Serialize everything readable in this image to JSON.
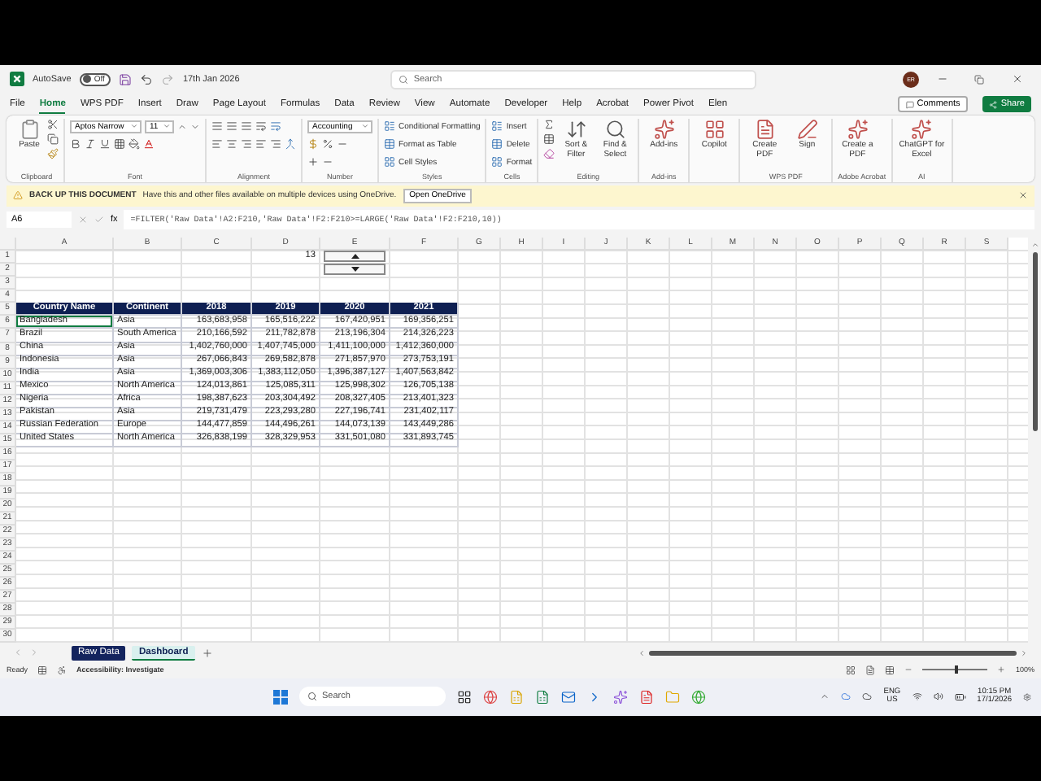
{
  "title_bar": {
    "autosave_label": "AutoSave",
    "autosave": {
      "label": "Off",
      "on": false
    },
    "file_name": "17th Jan 2026",
    "search_placeholder": "Search",
    "avatar": "ER"
  },
  "menu_tabs": [
    {
      "label": "File",
      "selected": false
    },
    {
      "label": "Home",
      "selected": true
    },
    {
      "label": "WPS PDF",
      "selected": false
    },
    {
      "label": "Insert",
      "selected": false
    },
    {
      "label": "Draw",
      "selected": false
    },
    {
      "label": "Page Layout",
      "selected": false
    },
    {
      "label": "Formulas",
      "selected": false
    },
    {
      "label": "Data",
      "selected": false
    },
    {
      "label": "Review",
      "selected": false
    },
    {
      "label": "View",
      "selected": false
    },
    {
      "label": "Automate",
      "selected": false
    },
    {
      "label": "Developer",
      "selected": false
    },
    {
      "label": "Help",
      "selected": false
    },
    {
      "label": "Acrobat",
      "selected": false
    },
    {
      "label": "Power Pivot",
      "selected": false
    },
    {
      "label": "Elen",
      "selected": false
    }
  ],
  "comments_button": "Comments",
  "share_button": "Share",
  "ribbon": {
    "groups": [
      {
        "kind": "clipboard",
        "label": "Clipboard",
        "paste": "Paste"
      },
      {
        "kind": "font",
        "label": "Font",
        "font": "Aptos Narrow",
        "size": "11"
      },
      {
        "kind": "alignment",
        "label": "Alignment"
      },
      {
        "kind": "number",
        "label": "Number",
        "format": "Accounting"
      },
      {
        "kind": "list",
        "label": "Styles",
        "items": [
          "Conditional Formatting",
          "Format as Table",
          "Cell Styles"
        ]
      },
      {
        "kind": "list",
        "label": "Cells",
        "items": [
          "Insert",
          "Delete",
          "Format"
        ]
      },
      {
        "kind": "editing",
        "label": "Editing",
        "items": [
          "Sort & Filter",
          "Find & Select"
        ]
      },
      {
        "kind": "large",
        "label": "Add-ins",
        "items": [
          "Add-ins"
        ]
      },
      {
        "kind": "large",
        "items": [
          "Copilot"
        ]
      },
      {
        "kind": "large",
        "label": "WPS PDF",
        "items": [
          "Create PDF",
          "Sign"
        ]
      },
      {
        "kind": "large",
        "label": "Adobe Acrobat",
        "items": [
          "Create a PDF"
        ]
      },
      {
        "kind": "large",
        "label": "AI",
        "items": [
          "ChatGPT for Excel"
        ]
      }
    ]
  },
  "message_bar": {
    "title": "BACK UP THIS DOCUMENT",
    "text": "Have this and other files available on multiple devices using OneDrive.",
    "button": "Open OneDrive"
  },
  "formula_bar": {
    "name_box": "A6",
    "function_label": "fx",
    "formula": "=FILTER('Raw Data'!A2:F210,'Raw Data'!F2:F210>=LARGE('Raw Data'!F2:F210,10))"
  },
  "sheet": {
    "columns": [
      "A",
      "B",
      "C",
      "D",
      "E",
      "F",
      "G",
      "H",
      "I",
      "J",
      "K",
      "L",
      "M",
      "N",
      "O",
      "P",
      "Q",
      "R",
      "S"
    ],
    "row_numbers": [
      "1",
      "2",
      "3",
      "4",
      "5",
      "6",
      "7",
      "8",
      "9",
      "10",
      "11",
      "12",
      "13",
      "14",
      "15",
      "16",
      "17",
      "18",
      "19",
      "20",
      "21",
      "22",
      "23",
      "24",
      "25",
      "26",
      "27",
      "28",
      "29",
      "30"
    ],
    "spinner_value": "13",
    "table": {
      "columns": [
        "Country Name",
        "Continent",
        "2018",
        "2019",
        "2020",
        "2021"
      ],
      "rows": [
        {
          "cells": [
            "Bangladesh",
            "Asia",
            "163,683,958",
            "165,516,222",
            "167,420,951",
            "169,356,251"
          ],
          "selected": true
        },
        {
          "cells": [
            "Brazil",
            "South America",
            "210,166,592",
            "211,782,878",
            "213,196,304",
            "214,326,223"
          ],
          "selected": false
        },
        {
          "cells": [
            "China",
            "Asia",
            "1,402,760,000",
            "1,407,745,000",
            "1,411,100,000",
            "1,412,360,000"
          ],
          "selected": false
        },
        {
          "cells": [
            "Indonesia",
            "Asia",
            "267,066,843",
            "269,582,878",
            "271,857,970",
            "273,753,191"
          ],
          "selected": false
        },
        {
          "cells": [
            "India",
            "Asia",
            "1,369,003,306",
            "1,383,112,050",
            "1,396,387,127",
            "1,407,563,842"
          ],
          "selected": false
        },
        {
          "cells": [
            "Mexico",
            "North America",
            "124,013,861",
            "125,085,311",
            "125,998,302",
            "126,705,138"
          ],
          "selected": false
        },
        {
          "cells": [
            "Nigeria",
            "Africa",
            "198,387,623",
            "203,304,492",
            "208,327,405",
            "213,401,323"
          ],
          "selected": false
        },
        {
          "cells": [
            "Pakistan",
            "Asia",
            "219,731,479",
            "223,293,280",
            "227,196,741",
            "231,402,117"
          ],
          "selected": false
        },
        {
          "cells": [
            "Russian Federation",
            "Europe",
            "144,477,859",
            "144,496,261",
            "144,073,139",
            "143,449,286"
          ],
          "selected": false
        },
        {
          "cells": [
            "United States",
            "North America",
            "326,838,199",
            "328,329,953",
            "331,501,080",
            "331,893,745"
          ],
          "selected": false
        }
      ]
    }
  },
  "sheet_tabs": [
    {
      "label": "Raw Data",
      "selected": false,
      "color": "#14245e"
    },
    {
      "label": "Dashboard",
      "selected": true,
      "color": "#d9f0ee"
    }
  ],
  "status_bar": {
    "status": "Ready",
    "accessibility": "Accessibility: Investigate",
    "zoom": "100%",
    "level": 0.5
  },
  "taskbar": {
    "search_placeholder": "Search",
    "language": "ENG",
    "region": "US",
    "time": "10:15 PM",
    "date": "17/1/2026"
  }
}
